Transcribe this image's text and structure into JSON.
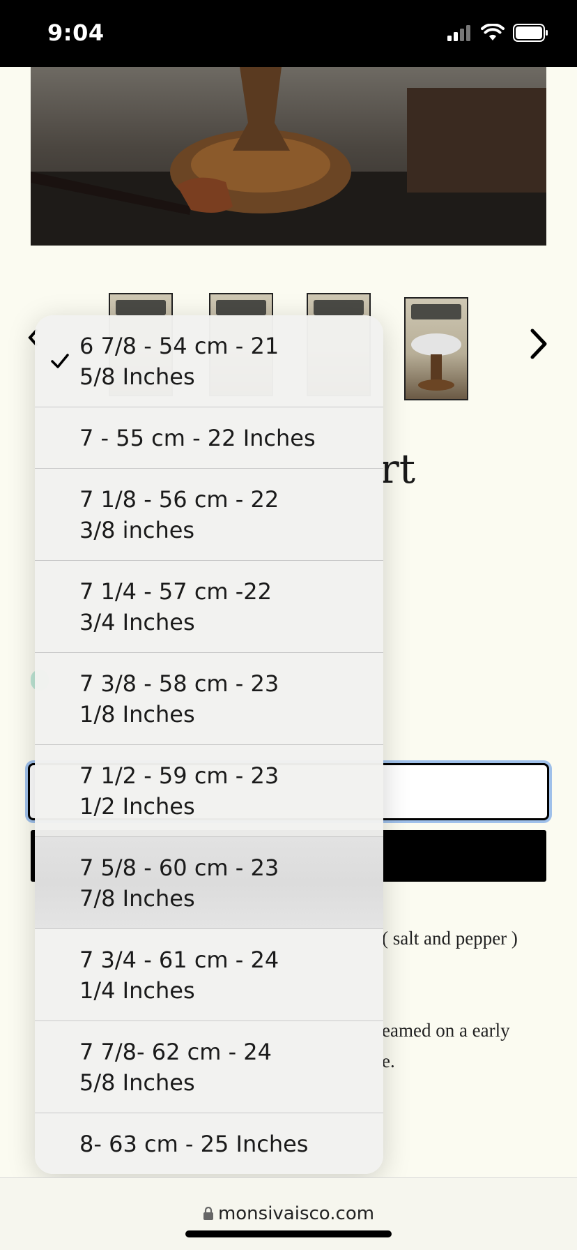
{
  "status": {
    "time": "9:04"
  },
  "page": {
    "title_fragment": "rt",
    "desc_fragment_1": "( salt and pepper )",
    "desc_fragment_2": "eamed on a early",
    "desc_fragment_3": "e."
  },
  "size_menu": {
    "selected_index": 0,
    "options": [
      {
        "line1": "6 7/8 - 54 cm - 21",
        "line2": "5/8 Inches"
      },
      {
        "line1": "7 - 55 cm - 22 Inches",
        "line2": ""
      },
      {
        "line1": "7 1/8 - 56 cm - 22",
        "line2": "3/8 inches"
      },
      {
        "line1": "7 1/4 - 57 cm -22",
        "line2": "3/4 Inches"
      },
      {
        "line1": "7 3/8 - 58 cm - 23",
        "line2": "1/8 Inches"
      },
      {
        "line1": "7 1/2 - 59 cm - 23",
        "line2": "1/2 Inches"
      },
      {
        "line1": "7 5/8 - 60 cm - 23",
        "line2": "7/8 Inches"
      },
      {
        "line1": "7 3/4 - 61 cm - 24",
        "line2": "1/4 Inches"
      },
      {
        "line1": "7 7/8- 62 cm - 24",
        "line2": "5/8 Inches"
      },
      {
        "line1": "8- 63 cm - 25 Inches",
        "line2": ""
      }
    ]
  },
  "browser": {
    "url": "monsivaisco.com"
  },
  "colors": {
    "background": "#fbfbf1",
    "focus_ring": "#9fc0ea",
    "button": "#000000"
  }
}
